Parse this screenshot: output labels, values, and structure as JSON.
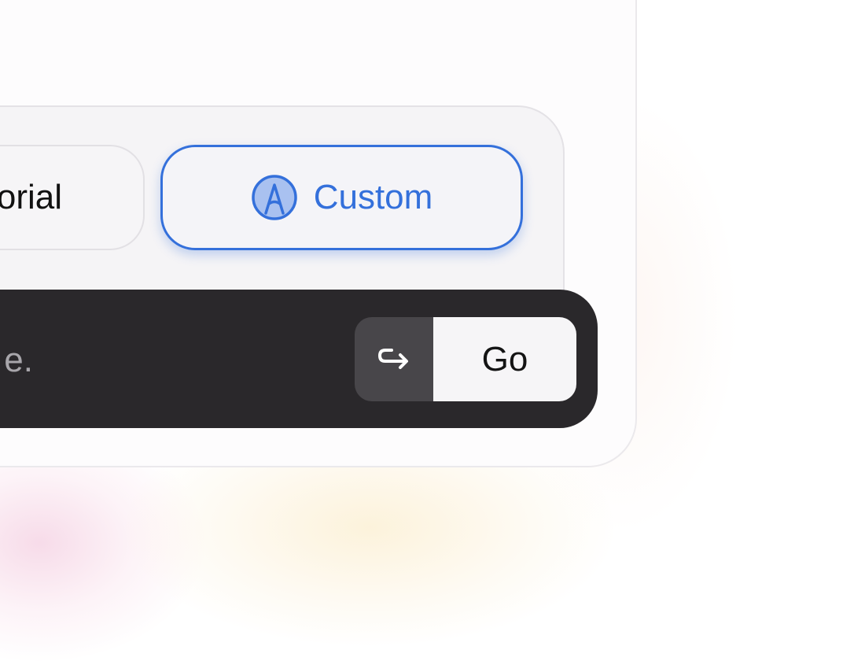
{
  "modes": {
    "tutorial": {
      "label": "Tutorial",
      "icon": "tutorial-icon"
    },
    "custom": {
      "label": "Custom",
      "icon": "custom-brush-icon",
      "selected": true
    }
  },
  "prompt": {
    "placeholder_tail": "e."
  },
  "actions": {
    "enter_icon": "enter-return-icon",
    "go_label": "Go"
  },
  "colors": {
    "accent": "#3470db",
    "prompt_bar": "#2a282b",
    "card_bg": "#fdfcfd",
    "panel_bg": "#f5f4f6"
  }
}
